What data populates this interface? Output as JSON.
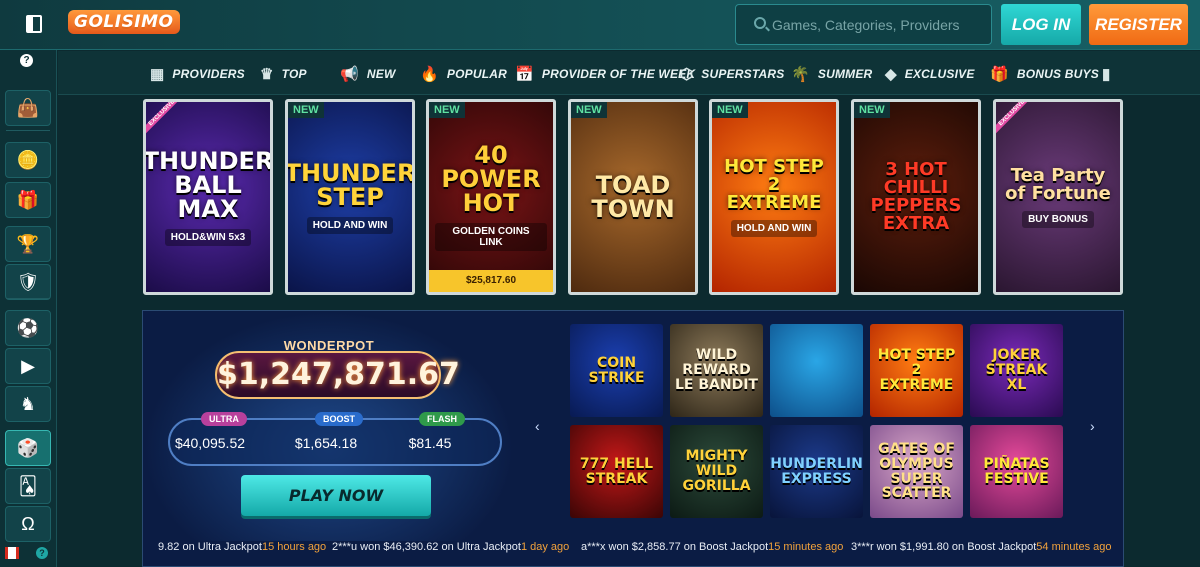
{
  "header": {
    "logo": "GOLISIMO",
    "search_placeholder": "Games, Categories, Providers",
    "login_label": "LOG IN",
    "register_label": "REGISTER"
  },
  "sidebar": {
    "help": "?",
    "items": [
      {
        "icon": "bag-icon",
        "glyph": "👜"
      },
      {
        "icon": "coin-icon",
        "glyph": "🪙"
      },
      {
        "icon": "gift-icon",
        "glyph": "🎁"
      },
      {
        "icon": "trophy-icon",
        "glyph": "🏆"
      },
      {
        "icon": "vip-shield-icon",
        "glyph": "🛡"
      },
      {
        "icon": "soccer-ball-icon",
        "glyph": "⚽"
      },
      {
        "icon": "video-play-icon",
        "glyph": "▶"
      },
      {
        "icon": "horse-icon",
        "glyph": "♞"
      },
      {
        "icon": "dice-icon",
        "glyph": "🎲"
      },
      {
        "icon": "cards-icon",
        "glyph": "🂡"
      },
      {
        "icon": "horseshoe-icon",
        "glyph": "Ω"
      }
    ],
    "active_index": 8
  },
  "categories": [
    {
      "label": "PROVIDERS",
      "icon": "providers-icon",
      "glyph": "▦"
    },
    {
      "label": "TOP",
      "icon": "crown-icon",
      "glyph": "♛"
    },
    {
      "label": "NEW",
      "icon": "megaphone-icon",
      "glyph": "📢"
    },
    {
      "label": "POPULAR",
      "icon": "flame-icon",
      "glyph": "🔥"
    },
    {
      "label": "PROVIDER OF THE WEEK",
      "icon": "calendar-icon",
      "glyph": "📅"
    },
    {
      "label": "SUPERSTARS",
      "icon": "star-badge-icon",
      "glyph": "⬡"
    },
    {
      "label": "SUMMER",
      "icon": "palm-tree-icon",
      "glyph": "🌴"
    },
    {
      "label": "EXCLUSIVE",
      "icon": "diamond-icon",
      "glyph": "◆"
    },
    {
      "label": "BONUS BUYS",
      "icon": "gift-box-icon",
      "glyph": "🎁"
    },
    {
      "label": "",
      "icon": "more-icon",
      "glyph": "▮"
    }
  ],
  "featured_games": [
    {
      "title": "THUNDER BALL MAX",
      "sub": "HOLD&WIN 5x3",
      "badge": "EXCLUSIVE",
      "colors": [
        "#5b2ab0",
        "#1b0c48"
      ],
      "title_color": "#ffffff"
    },
    {
      "title": "THUNDER STEP",
      "sub": "HOLD AND WIN",
      "badge": "NEW",
      "colors": [
        "#1e3fa8",
        "#0a1448"
      ],
      "title_color": "#ffd43a"
    },
    {
      "title": "40 POWER HOT",
      "sub": "GOLDEN COINS LINK",
      "badge": "NEW",
      "colors": [
        "#7a1416",
        "#2a0606"
      ],
      "title_color": "#ffcf3a",
      "jackpot": "$25,817.60"
    },
    {
      "title": "TOAD TOWN",
      "sub": "",
      "badge": "NEW",
      "colors": [
        "#a96a2c",
        "#4e2a0f"
      ],
      "title_color": "#ffe9a6"
    },
    {
      "title": "HOT STEP 2 EXTREME",
      "sub": "HOLD AND WIN",
      "badge": "NEW",
      "colors": [
        "#ff7d12",
        "#b32400"
      ],
      "title_color": "#ffe83a"
    },
    {
      "title": "3 HOT CHILLI PEPPERS EXTRA",
      "sub": "",
      "badge": "NEW",
      "colors": [
        "#5e1e0c",
        "#1a0703"
      ],
      "title_color": "#ff3a26"
    },
    {
      "title": "Tea Party of Fortune",
      "sub": "BUY BONUS",
      "badge": "EXCLUSIVE",
      "colors": [
        "#6b3b7a",
        "#2a1630"
      ],
      "title_color": "#ffe0a0"
    }
  ],
  "wonderpot": {
    "title": "WONDERPOT",
    "main": "$1,247,871.67",
    "tiers": [
      {
        "label": "ULTRA",
        "value": "$40,095.52",
        "color": "#b8409c"
      },
      {
        "label": "BOOST",
        "value": "$1,654.18",
        "color": "#2a6ccc"
      },
      {
        "label": "FLASH",
        "value": "$81.45",
        "color": "#2f9a4a"
      }
    ],
    "play_label": "PLAY NOW"
  },
  "mini_games": [
    {
      "title": "COIN STRIKE",
      "colors": [
        "#1b3fb0",
        "#081a52"
      ],
      "title_color": "#ffd23a"
    },
    {
      "title": "WILD REWARD LE BANDIT",
      "colors": [
        "#8d7a5a",
        "#2e2618"
      ],
      "title_color": "#fff4d6"
    },
    {
      "title": "",
      "colors": [
        "#2aa6e6",
        "#0d4f8a"
      ],
      "title_color": "#ffffff"
    },
    {
      "title": "HOT STEP 2 EXTREME",
      "colors": [
        "#ff7d12",
        "#b32400"
      ],
      "title_color": "#ffe83a"
    },
    {
      "title": "JOKER STREAK XL",
      "colors": [
        "#7a2ab8",
        "#2a0b52"
      ],
      "title_color": "#ffd23a"
    },
    {
      "title": "777 HELL STREAK",
      "colors": [
        "#c31818",
        "#3a0505"
      ],
      "title_color": "#ffd23a"
    },
    {
      "title": "MIGHTY WILD GORILLA",
      "colors": [
        "#2c4a3a",
        "#0c1a14"
      ],
      "title_color": "#ffd23a"
    },
    {
      "title": "THUNDERLINE EXPRESS",
      "colors": [
        "#1c3a8a",
        "#08143a"
      ],
      "title_color": "#7fd0ff"
    },
    {
      "title": "GATES OF OLYMPUS SUPER SCATTER",
      "colors": [
        "#d9a7c8",
        "#7a4a8a"
      ],
      "title_color": "#ffe089"
    },
    {
      "title": "PIÑATAS FESTIVE",
      "colors": [
        "#e64a9a",
        "#6a1a5a"
      ],
      "title_color": "#ffe83a"
    }
  ],
  "ticker": [
    {
      "text": "9.82 on Ultra Jackpot",
      "time": "15 hours ago"
    },
    {
      "text": "2***u won $46,390.62 on Ultra Jackpot",
      "time": "1 day ago"
    },
    {
      "text": "a***x won $2,858.77 on Boost Jackpot",
      "time": "15 minutes ago"
    },
    {
      "text": "3***r won $1,991.80 on Boost Jackpot",
      "time": "54 minutes ago"
    }
  ]
}
